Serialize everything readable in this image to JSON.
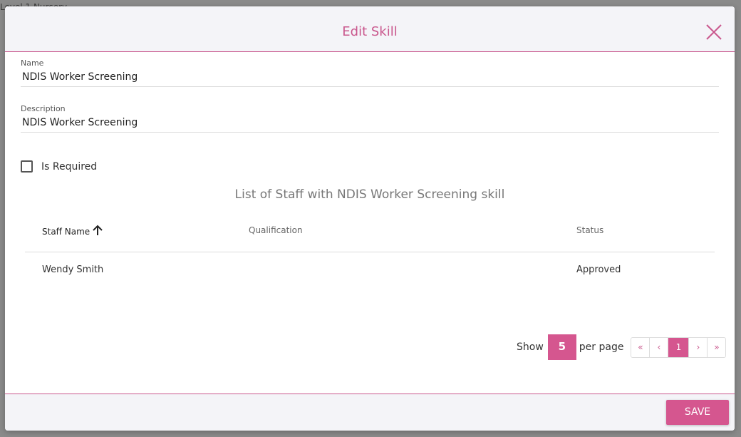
{
  "background": {
    "breadcrumb_fragment": "Level 1 Nursery"
  },
  "modal": {
    "title": "Edit Skill",
    "close_icon": "close-icon",
    "accent_color": "#d5568f"
  },
  "form": {
    "name_label": "Name",
    "name_value": "NDIS Worker Screening",
    "description_label": "Description",
    "description_value": "NDIS Worker Screening",
    "is_required_label": "Is Required",
    "is_required_checked": false
  },
  "staff_list": {
    "title": "List of Staff with NDIS Worker Screening skill",
    "columns": [
      "Staff Name",
      "Qualification",
      "Status"
    ],
    "sort_icon": "arrow-up-icon",
    "rows": [
      {
        "staff_name": "Wendy Smith",
        "qualification": "",
        "status": "Approved"
      }
    ]
  },
  "pagination": {
    "show_label": "Show",
    "per_page_value": "5",
    "per_page_label": "per page",
    "first": "«",
    "prev": "‹",
    "current_page": "1",
    "next": "›",
    "last": "»"
  },
  "footer": {
    "save_label": "SAVE"
  }
}
